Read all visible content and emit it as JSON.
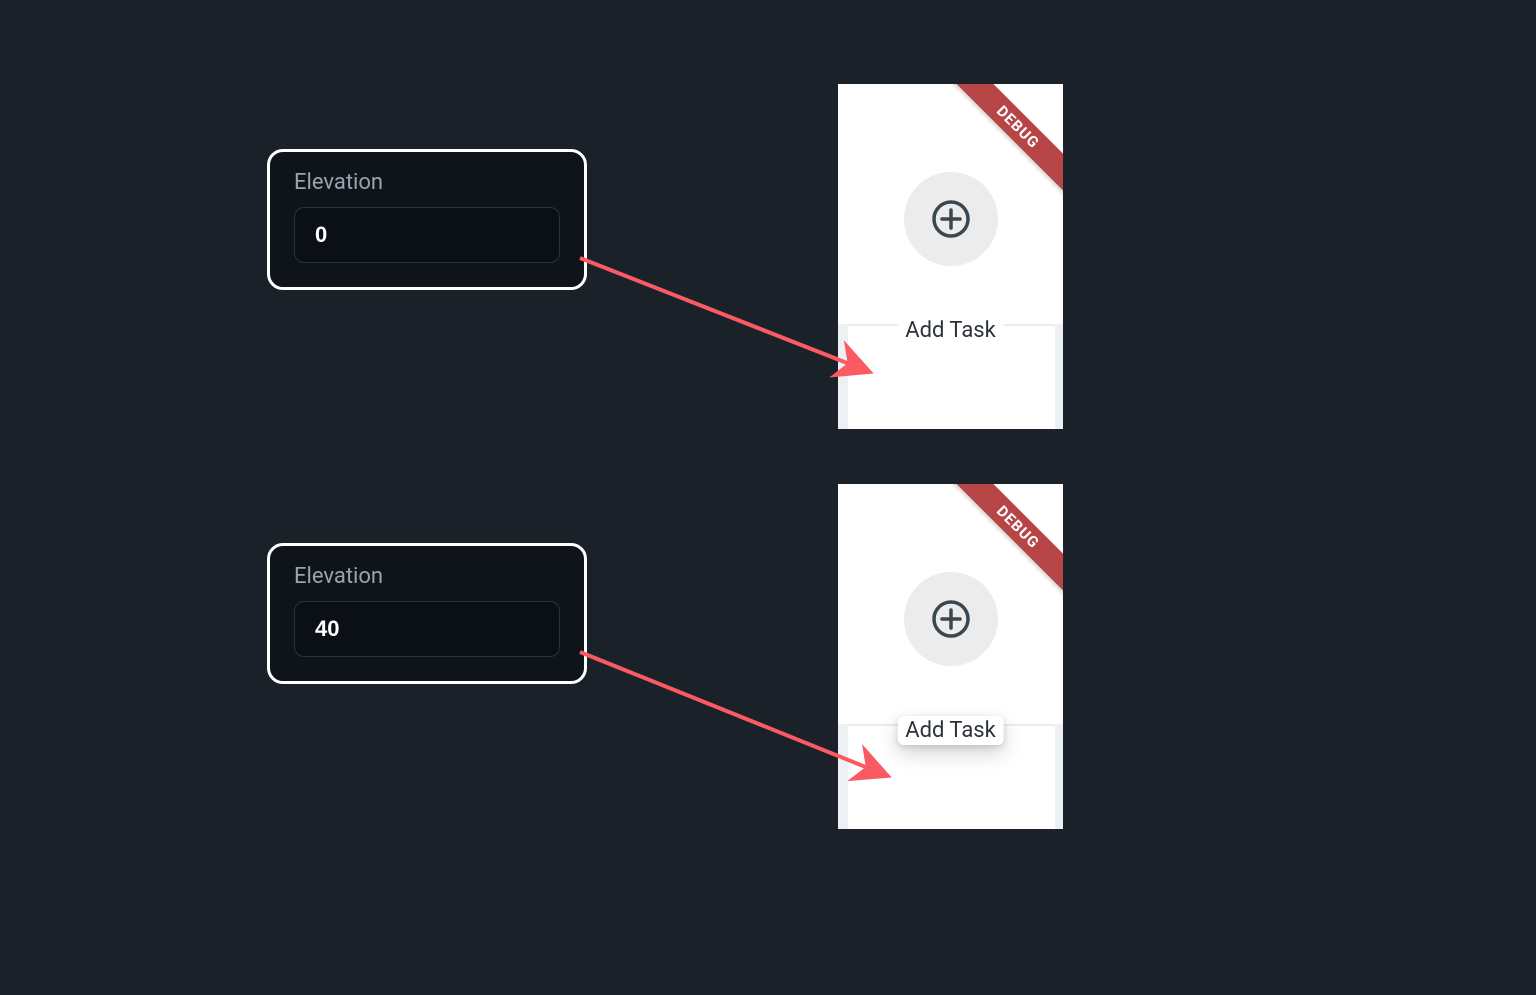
{
  "examples": [
    {
      "panel": {
        "label": "Elevation",
        "value": "0"
      },
      "preview": {
        "debug_text": "DEBUG",
        "task_label": "Add Task"
      }
    },
    {
      "panel": {
        "label": "Elevation",
        "value": "40"
      },
      "preview": {
        "debug_text": "DEBUG",
        "task_label": "Add Task"
      }
    }
  ],
  "colors": {
    "arrow": "#fa5a61",
    "panel_bg": "#0e141a",
    "panel_border": "#ffffff",
    "body_bg": "#1a2129",
    "debug_bg": "#b74545"
  }
}
